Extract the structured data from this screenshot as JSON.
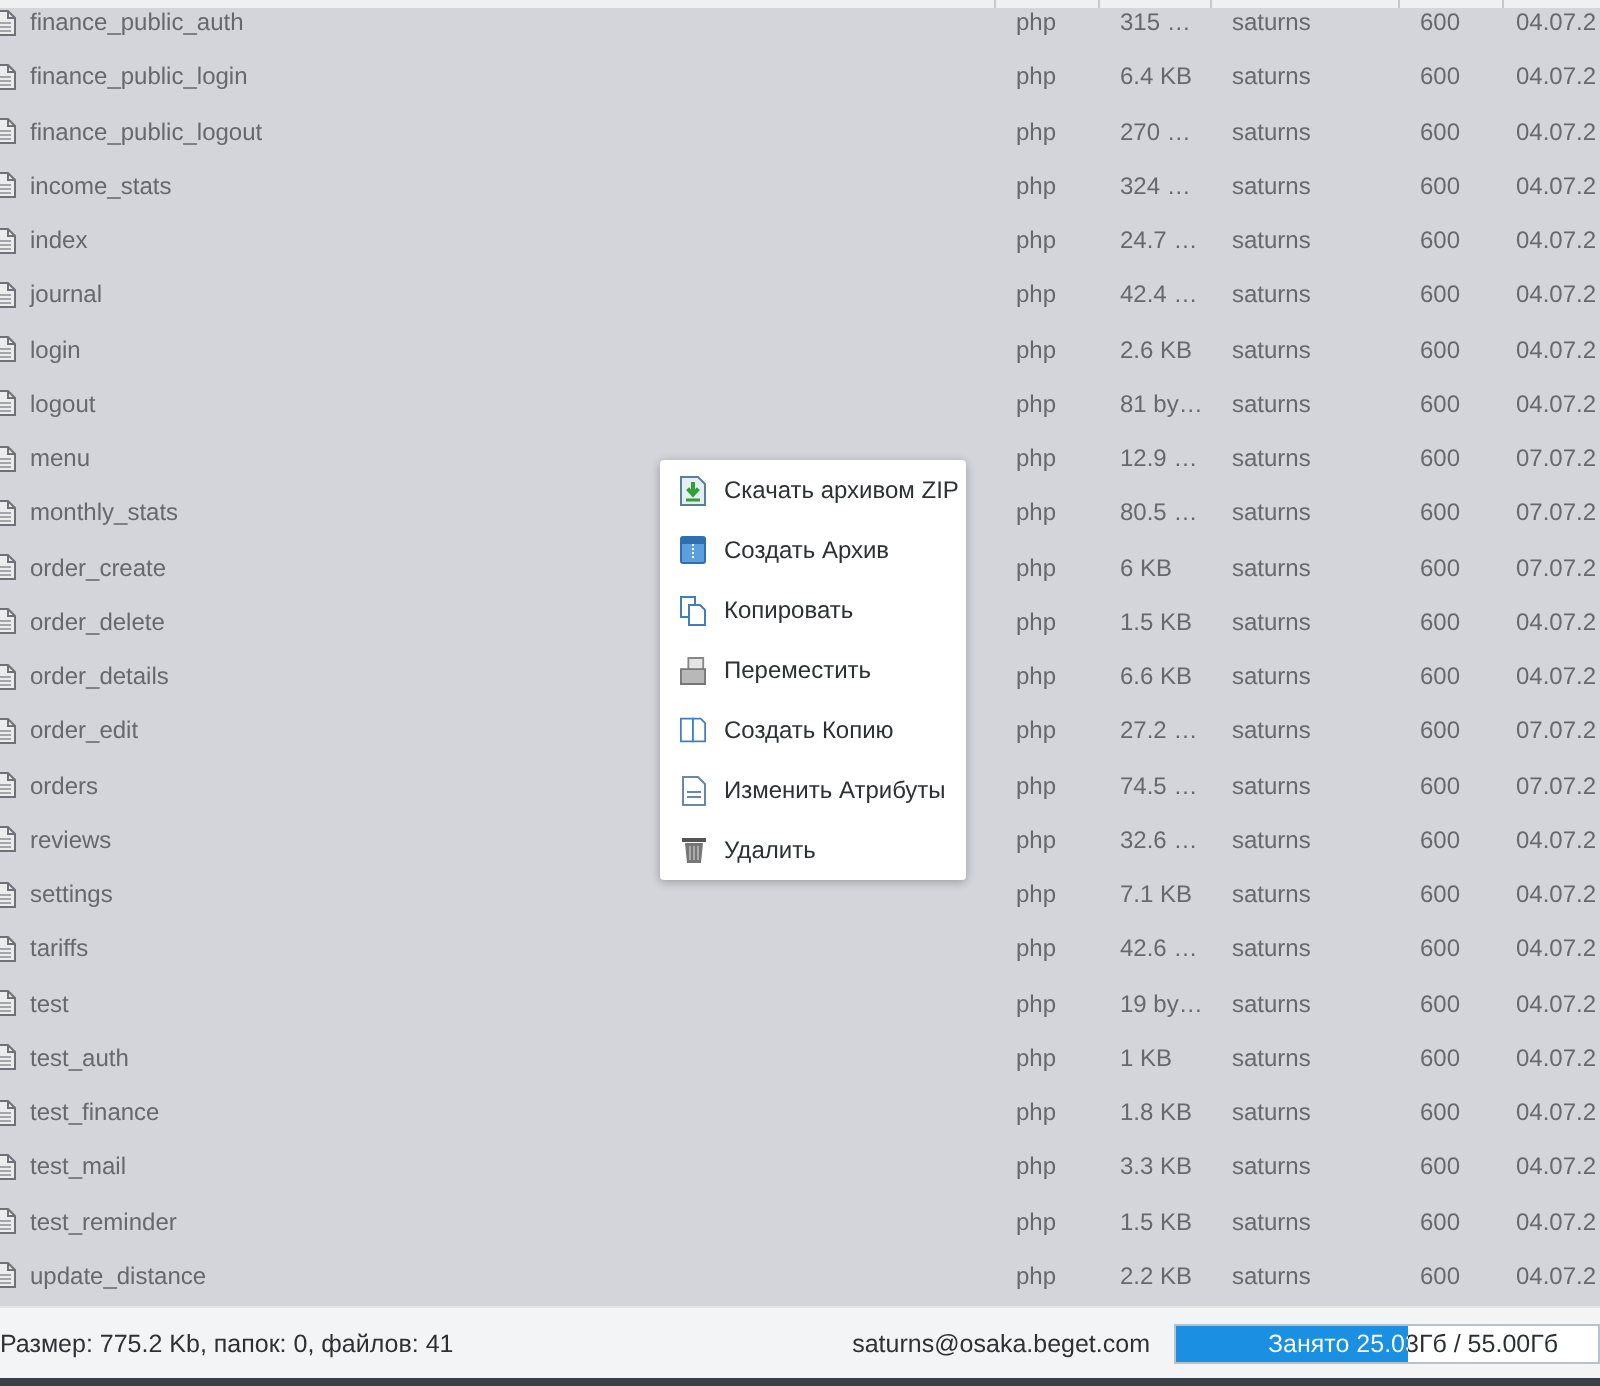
{
  "table": {
    "rows": [
      {
        "cells": [
          "finance_public_auth",
          "php",
          "315 …",
          "saturns",
          "600",
          "04.07.2"
        ]
      },
      {
        "cells": [
          "finance_public_login",
          "php",
          "6.4 KB",
          "saturns",
          "600",
          "04.07.2"
        ]
      },
      {
        "cells": [
          "finance_public_logout",
          "php",
          "270 …",
          "saturns",
          "600",
          "04.07.2"
        ]
      },
      {
        "cells": [
          "income_stats",
          "php",
          "324 …",
          "saturns",
          "600",
          "04.07.2"
        ]
      },
      {
        "cells": [
          "index",
          "php",
          "24.7 …",
          "saturns",
          "600",
          "04.07.2"
        ]
      },
      {
        "cells": [
          "journal",
          "php",
          "42.4 …",
          "saturns",
          "600",
          "04.07.2"
        ]
      },
      {
        "cells": [
          "login",
          "php",
          "2.6 KB",
          "saturns",
          "600",
          "04.07.2"
        ]
      },
      {
        "cells": [
          "logout",
          "php",
          "81 by…",
          "saturns",
          "600",
          "04.07.2"
        ]
      },
      {
        "cells": [
          "menu",
          "php",
          "12.9 …",
          "saturns",
          "600",
          "07.07.2"
        ]
      },
      {
        "cells": [
          "monthly_stats",
          "php",
          "80.5 …",
          "saturns",
          "600",
          "07.07.2"
        ]
      },
      {
        "cells": [
          "order_create",
          "php",
          "6 KB",
          "saturns",
          "600",
          "07.07.2"
        ]
      },
      {
        "cells": [
          "order_delete",
          "php",
          "1.5 KB",
          "saturns",
          "600",
          "04.07.2"
        ]
      },
      {
        "cells": [
          "order_details",
          "php",
          "6.6 KB",
          "saturns",
          "600",
          "04.07.2"
        ]
      },
      {
        "cells": [
          "order_edit",
          "php",
          "27.2 …",
          "saturns",
          "600",
          "07.07.2"
        ]
      },
      {
        "cells": [
          "orders",
          "php",
          "74.5 …",
          "saturns",
          "600",
          "07.07.2"
        ]
      },
      {
        "cells": [
          "reviews",
          "php",
          "32.6 …",
          "saturns",
          "600",
          "04.07.2"
        ]
      },
      {
        "cells": [
          "settings",
          "php",
          "7.1 KB",
          "saturns",
          "600",
          "04.07.2"
        ]
      },
      {
        "cells": [
          "tariffs",
          "php",
          "42.6 …",
          "saturns",
          "600",
          "04.07.2"
        ]
      },
      {
        "cells": [
          "test",
          "php",
          "19 by…",
          "saturns",
          "600",
          "04.07.2"
        ]
      },
      {
        "cells": [
          "test_auth",
          "php",
          "1 KB",
          "saturns",
          "600",
          "04.07.2"
        ]
      },
      {
        "cells": [
          "test_finance",
          "php",
          "1.8 KB",
          "saturns",
          "600",
          "04.07.2"
        ]
      },
      {
        "cells": [
          "test_mail",
          "php",
          "3.3 KB",
          "saturns",
          "600",
          "04.07.2"
        ]
      },
      {
        "cells": [
          "test_reminder",
          "php",
          "1.5 KB",
          "saturns",
          "600",
          "04.07.2"
        ]
      },
      {
        "cells": [
          "update_distance",
          "php",
          "2.2 KB",
          "saturns",
          "600",
          "04.07.2"
        ]
      }
    ]
  },
  "context_menu": {
    "items": [
      {
        "label": "Скачать архивом ZIP"
      },
      {
        "label": "Создать Архив"
      },
      {
        "label": "Копировать"
      },
      {
        "label": "Переместить"
      },
      {
        "label": "Создать Копию"
      },
      {
        "label": "Изменить Атрибуты"
      },
      {
        "label": "Удалить"
      }
    ]
  },
  "status_bar": {
    "summary": "Размер: 775.2 Kb, папок: 0, файлов: 41",
    "account": "saturns@osaka.beget.com",
    "quota": {
      "label": "Занято 25.03Гб / 55.00Гб",
      "level": 0.55
    }
  }
}
